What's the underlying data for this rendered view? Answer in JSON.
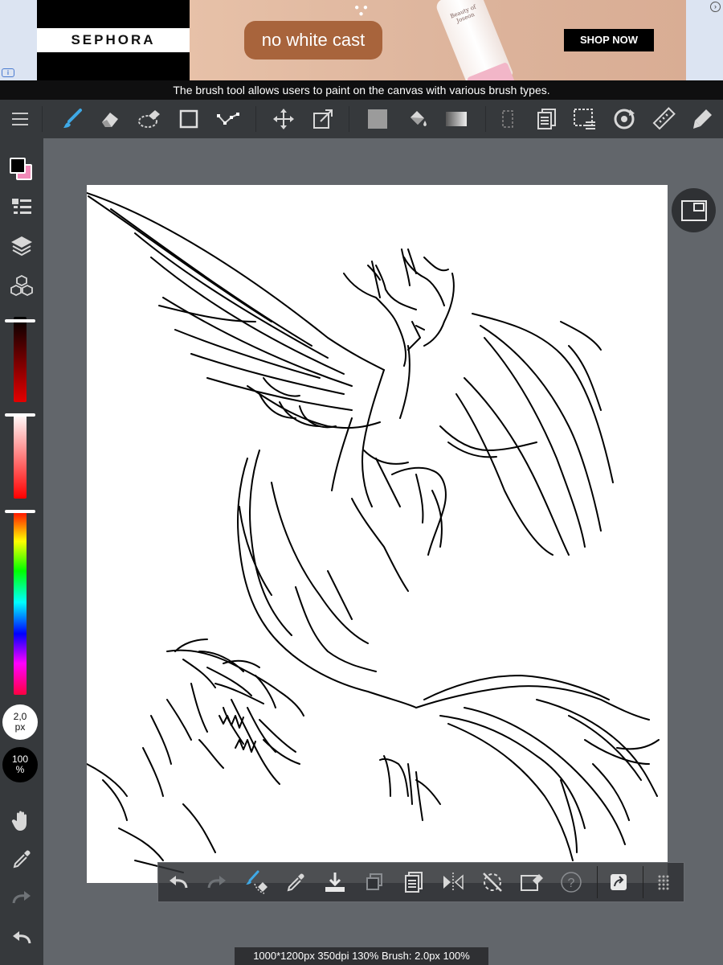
{
  "ad": {
    "brand": "SEPHORA",
    "headline": "no white cast",
    "cta": "SHOP NOW",
    "product_text": "Beauty of Joseon",
    "info_icon": "info-icon",
    "close_icon": "close-icon"
  },
  "tip": "The brush tool allows users to paint on the canvas with various brush types.",
  "toolbar": {
    "tools": [
      {
        "name": "menu-icon"
      },
      {
        "name": "brush-icon",
        "active": true
      },
      {
        "name": "eraser-icon"
      },
      {
        "name": "lasso-eraser-icon"
      },
      {
        "name": "rectangle-icon"
      },
      {
        "name": "polyline-icon"
      },
      {
        "name": "move-icon"
      },
      {
        "name": "transform-icon"
      },
      {
        "name": "fill-color-icon"
      },
      {
        "name": "bucket-icon"
      },
      {
        "name": "gradient-icon"
      },
      {
        "name": "selection-icon"
      },
      {
        "name": "layer-copy-icon"
      },
      {
        "name": "select-list-icon"
      },
      {
        "name": "rotate-view-icon"
      },
      {
        "name": "ruler-icon"
      },
      {
        "name": "pen-material-icon"
      }
    ],
    "accent": "#3fa9e6"
  },
  "sidebar": {
    "foreground_color": "#000000",
    "background_color": "#f28ab8",
    "brush_size": {
      "value": "2,0",
      "unit": "px"
    },
    "opacity": {
      "value": "100",
      "unit": "%"
    },
    "brightness_level": 0.05,
    "saturation_level": 0.0,
    "hue_level": 0.0
  },
  "quickbar": {
    "buttons": [
      "undo-icon",
      "redo-icon",
      "brush-eraser-swap-icon",
      "eyedropper-icon",
      "save-icon",
      "duplicate-icon",
      "paste-icon",
      "flip-horizontal-icon",
      "hide-rotation-icon",
      "transparent-eraser-icon",
      "help-icon",
      "share-icon",
      "grid-handle-icon"
    ],
    "help_label": "?"
  },
  "status": "1000*1200px 350dpi 130% Brush: 2.0px 100%"
}
